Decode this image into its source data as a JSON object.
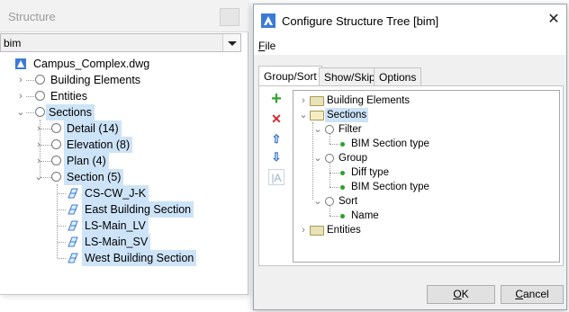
{
  "structure_panel": {
    "title": "Structure",
    "filter_value": "bim",
    "tree": {
      "root": "Campus_Complex.dwg",
      "building_elements": "Building Elements",
      "entities": "Entities",
      "sections": "Sections",
      "detail": "Detail (14)",
      "elevation": "Elevation (8)",
      "plan": "Plan (4)",
      "section": "Section (5)",
      "section_items": [
        "CS-CW_J-K",
        "East Building Section",
        "LS-Main_LV",
        "LS-Main_SV",
        "West Building Section"
      ]
    }
  },
  "dialog": {
    "title": "Configure Structure Tree [bim]",
    "close_glyph": "✕",
    "menu_file_u": "F",
    "menu_file_rest": "ile",
    "tabs": [
      "Group/Sort",
      "Show/Skip",
      "Options"
    ],
    "toolbar": {
      "add": "+",
      "delete": "✕",
      "up": "⇧",
      "down": "⇩",
      "text": "|A"
    },
    "tree": {
      "building_elements": "Building Elements",
      "sections": "Sections",
      "filter": "Filter",
      "bim_section_type_1": "BIM Section type",
      "group": "Group",
      "diff_type": "Diff type",
      "bim_section_type_2": "BIM Section type",
      "sort": "Sort",
      "name": "Name",
      "entities": "Entities"
    },
    "ok_u": "O",
    "ok_rest": "K",
    "cancel_u": "C",
    "cancel_rest": "ancel"
  },
  "colors": {
    "highlight": "#cde3f7",
    "app_icon": "#3a7bd5",
    "add_green": "#2fa52f",
    "delete_red": "#d8262b",
    "arrow_blue": "#2d6fc4"
  }
}
